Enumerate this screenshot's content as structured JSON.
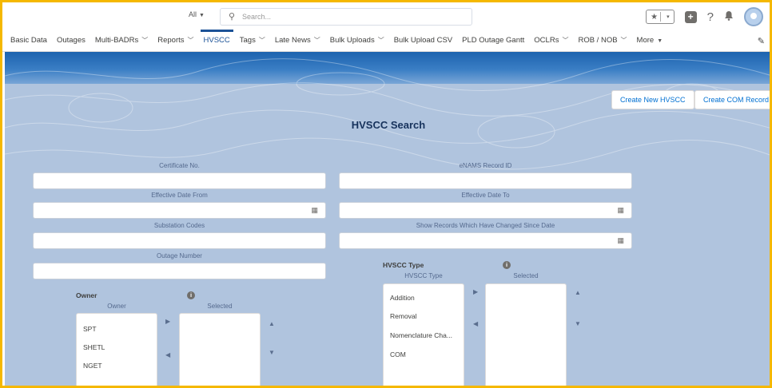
{
  "header": {
    "scope_label": "All",
    "search_placeholder": "Search..."
  },
  "nav": [
    {
      "label": "Basic Data",
      "chevron": false
    },
    {
      "label": "Outages",
      "chevron": false
    },
    {
      "label": "Multi-BADRs",
      "chevron": true
    },
    {
      "label": "Reports",
      "chevron": true
    },
    {
      "label": "HVSCC",
      "chevron": false,
      "active": true
    },
    {
      "label": "Tags",
      "chevron": true
    },
    {
      "label": "Late News",
      "chevron": true
    },
    {
      "label": "Bulk Uploads",
      "chevron": true
    },
    {
      "label": "Bulk Upload CSV",
      "chevron": false
    },
    {
      "label": "PLD Outage Gantt",
      "chevron": false
    },
    {
      "label": "OCLRs",
      "chevron": true
    },
    {
      "label": "ROB / NOB",
      "chevron": true
    },
    {
      "label": "More",
      "chevron": true,
      "caret": "▼"
    }
  ],
  "actions": {
    "create_hvscc": "Create New HVSCC",
    "create_com": "Create COM Record"
  },
  "page": {
    "title": "HVSCC Search"
  },
  "form": {
    "certificate_no": {
      "label": "Certificate No.",
      "value": ""
    },
    "enams_record_id": {
      "label": "eNAMS Record ID",
      "value": ""
    },
    "effective_from": {
      "label": "Effective Date From",
      "value": ""
    },
    "effective_to": {
      "label": "Effective Date To",
      "value": ""
    },
    "substation_codes": {
      "label": "Substation Codes",
      "value": ""
    },
    "changed_since": {
      "label": "Show Records Which Have Changed Since Date",
      "value": ""
    },
    "outage_number": {
      "label": "Outage Number",
      "value": ""
    }
  },
  "owner": {
    "label": "Owner",
    "available_label": "Owner",
    "selected_label": "Selected",
    "options": [
      "SPT",
      "SHETL",
      "NGET"
    ]
  },
  "hvscc_type": {
    "label": "HVSCC Type",
    "available_label": "HVSCC Type",
    "selected_label": "Selected",
    "options": [
      "Addition",
      "Removal",
      "Nomenclature Cha...",
      "COM"
    ]
  },
  "colors": {
    "frame": "#f5b800",
    "background": "#b0c4de",
    "banner": "#1d63ae",
    "active_tab": "#1b5297",
    "link": "#0070d2"
  },
  "icons": {
    "search": "search-icon",
    "calendar": "calendar-icon",
    "info": "info-icon",
    "favorites": "star-icon",
    "add": "plus-icon",
    "help": "help-icon",
    "notifications": "bell-icon",
    "edit": "pencil-icon"
  }
}
